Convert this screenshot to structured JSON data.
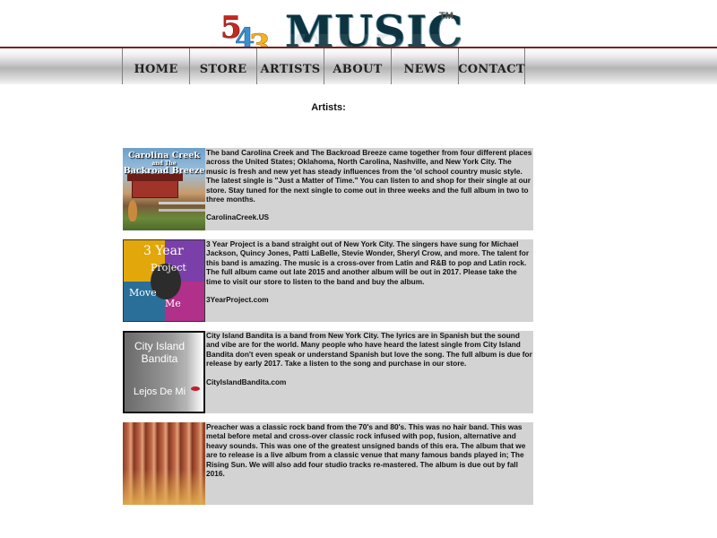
{
  "logo": {
    "number_a": "5",
    "number_b": "4",
    "number_c": "3",
    "text": "MUSIC",
    "tm": "TM"
  },
  "nav": [
    "HOME",
    "STORE",
    "ARTISTS",
    "ABOUT",
    "NEWS",
    "CONTACT"
  ],
  "page_title": "Artists:",
  "artists": [
    {
      "image_caption_top": "Carolina Creek",
      "image_caption_mid": "and The",
      "image_caption_bottom": "Backroad Breeze",
      "description": "The band Carolina Creek and The Backroad Breeze came together from four different places across the United States; Oklahoma, North Carolina, Nashville, and New York City. The music is fresh and new yet has steady influences from the 'ol school country music style. The latest single is \"Just a Matter of Time.\" You can listen to and shop for their single at our store. Stay tuned for the next single to come out in three weeks and the full album in two to three months.",
      "link": "CarolinaCreek.US"
    },
    {
      "image_caption_top": "3 Year",
      "image_caption_mid": "Project",
      "image_caption_bottom_1": "Move",
      "image_caption_bottom_2": "Me",
      "description": "3 Year Project is a band straight out of New York City. The singers have sung for Michael Jackson, Quincy Jones, Patti LaBelle, Stevie Wonder, Sheryl Crow, and more. The talent for this band is amazing. The music is a cross-over from Latin and R&B to pop and Latin rock. The full album came out late 2015 and another album will be out in 2017. Please take the time to visit our store to listen to the band and buy the album.",
      "link": "3YearProject.com"
    },
    {
      "image_caption_top": "City Island",
      "image_caption_mid": "Bandita",
      "image_caption_bottom": "Lejos De Mi",
      "description": "City Island Bandita is a band from New York City. The lyrics are in Spanish but the sound and vibe are for the world. Many people who have heard the latest single from City Island Bandita don't even speak or understand Spanish but love the song. The full album is due for release by early 2017. Take a listen to the song and purchase in our store.",
      "link": "CityIslandBandita.com"
    },
    {
      "description": "Preacher was a classic rock band from the 70's and 80's. This was no hair band. This was metal before metal and cross-over classic rock infused with pop, fusion, alternative and heavy sounds. This was one of the greatest unsigned bands of this era. The album that we are to release is a live album from a classic venue that many famous bands played in; The Rising Sun. We will also add four studio tracks re-mastered. The album is due out by fall 2016."
    }
  ]
}
